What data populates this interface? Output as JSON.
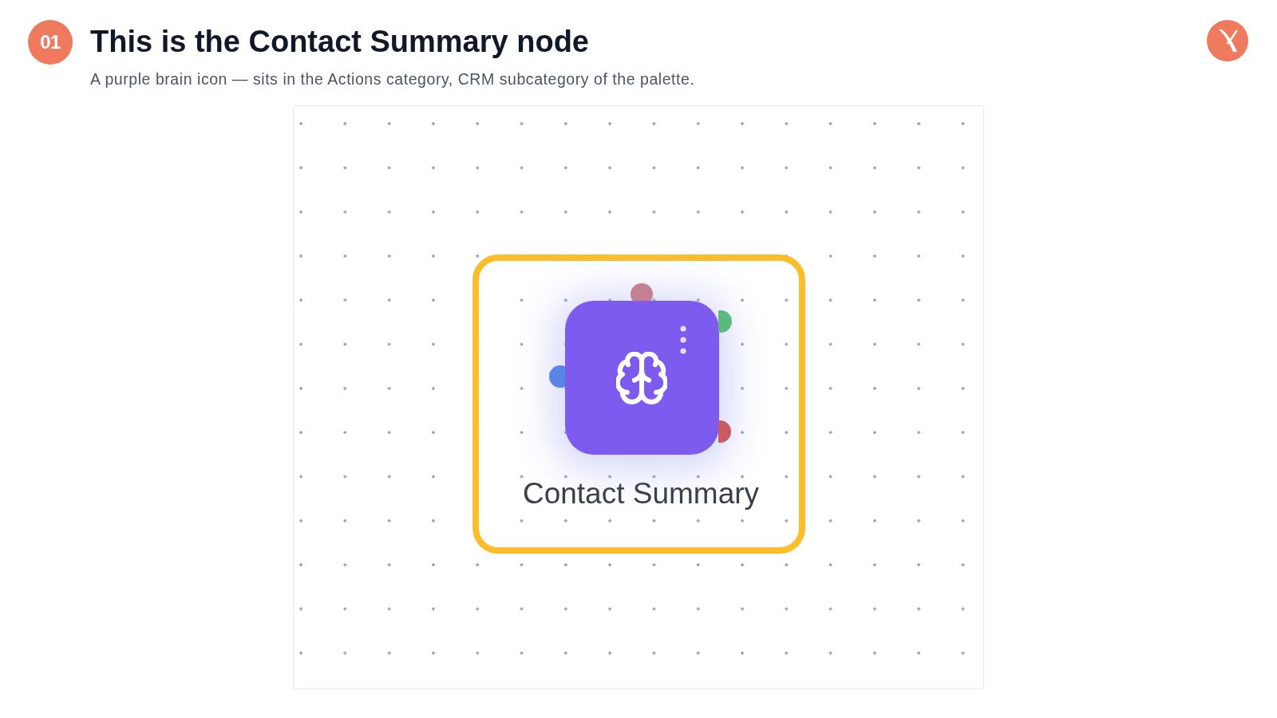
{
  "header": {
    "step_number": "01",
    "title": "This is the Contact Summary node",
    "subtitle": "A purple brain icon — sits in the Actions category, CRM subcategory of the palette."
  },
  "canvas": {
    "node": {
      "label": "Contact Summary",
      "highlighted": true,
      "handles": [
        {
          "color": "#c4818f"
        },
        {
          "color": "#5cb781"
        },
        {
          "color": "#5a84e6"
        },
        {
          "color": "#c75a63"
        }
      ]
    }
  }
}
